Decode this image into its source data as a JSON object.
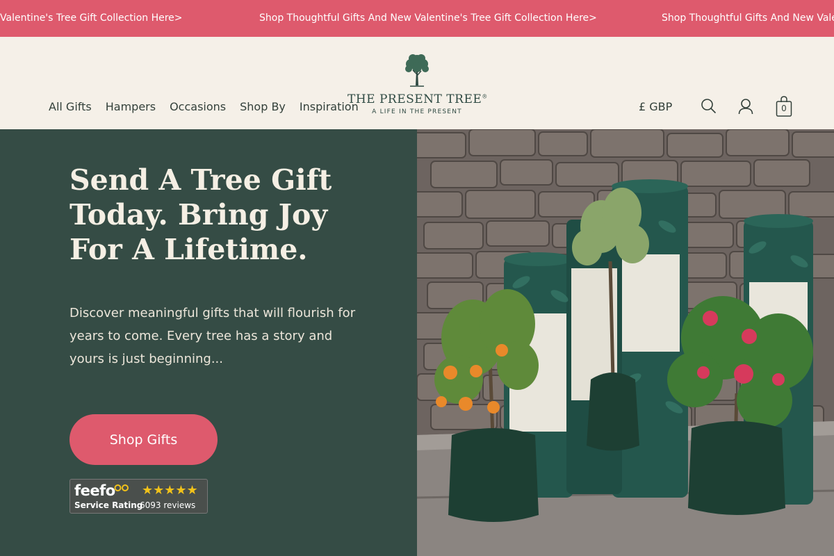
{
  "announcement": {
    "items": [
      "Valentine's Tree Gift Collection Here>",
      "Shop Thoughtful Gifts And New Valentine's Tree Gift Collection Here>",
      "Shop Thoughtful Gifts And New Valentine's Tree Gift Collection Here>"
    ]
  },
  "header": {
    "nav": [
      "All Gifts",
      "Hampers",
      "Occasions",
      "Shop By",
      "Inspiration"
    ],
    "logo": {
      "title": "THE PRESENT TREE",
      "mark": "®",
      "tagline": "A LIFE IN THE PRESENT"
    },
    "currency": "£ GBP",
    "icons": [
      "search-icon",
      "account-icon",
      "bag-icon"
    ],
    "cart_count": "0"
  },
  "hero": {
    "title": "Send A Tree Gift Today. Bring Joy For A Lifetime.",
    "text": "Discover meaningful gifts that will flourish for years to come. Every tree has a story and yours is just beginning...",
    "cta": "Shop Gifts"
  },
  "feefo": {
    "logo": "feefo",
    "label": "Service Rating",
    "rating": 5,
    "stars": "★★★★★",
    "reviews": "6093 reviews"
  },
  "colors": {
    "announcement_bg": "#de5a6d",
    "header_bg": "#f5f0e8",
    "hero_bg": "#354c45",
    "accent": "#de5a6d"
  }
}
